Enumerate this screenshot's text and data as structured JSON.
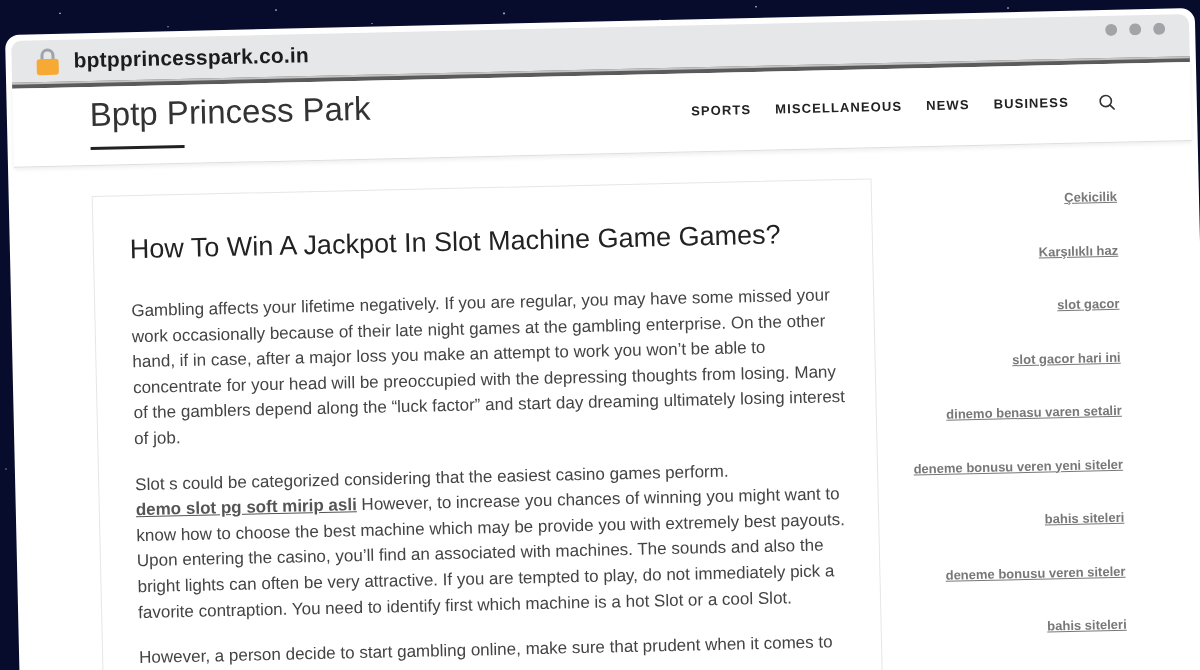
{
  "browser": {
    "url": "bptpprincesspark.co.in"
  },
  "header": {
    "site_title": "Bptp Princess Park",
    "nav": [
      "SPORTS",
      "MISCELLANEOUS",
      "NEWS",
      "BUSINESS"
    ]
  },
  "article": {
    "title": "How To Win A Jackpot In Slot Machine Game Games?",
    "paragraphs": [
      [
        {
          "kind": "text",
          "text": "Gambling affects your lifetime negatively. If you are regular, you may have some missed your work occasionally because of their late night games at the gambling enterprise. On the other hand, if in case, after a major loss you make an attempt to work you won’t be able to concentrate for your head will be preoccupied with the depressing thoughts from losing. Many of the gamblers depend along the “luck factor” and start day dreaming ultimately losing interest of job."
        }
      ],
      [
        {
          "kind": "text",
          "text": "Slot s could be categorized considering that the easiest casino games perform. "
        },
        {
          "kind": "link",
          "text": "demo slot pg soft mirip asli"
        },
        {
          "kind": "text",
          "text": " However, to increase you chances of winning you might want to know how to choose the best machine which may be provide you with extremely best payouts. Upon entering the casino, you’ll find an associated with machines. The sounds and also the bright lights can often be very attractive. If you are tempted to play, do not immediately pick a favorite contraption. You need to identify first which machine is a hot Slot or a cool Slot."
        }
      ],
      [
        {
          "kind": "text",
          "text": "However, a person decide to start gambling online, make sure that prudent when it comes to"
        }
      ]
    ]
  },
  "sidebar": {
    "links": [
      "Çekicilik",
      "Karşılıklı haz",
      "slot gacor",
      "slot gacor hari ini",
      "dinemo benasu varen setalir",
      "deneme bonusu veren yeni siteler",
      "bahis siteleri",
      "deneme bonusu veren siteler",
      "bahis siteleri"
    ]
  }
}
